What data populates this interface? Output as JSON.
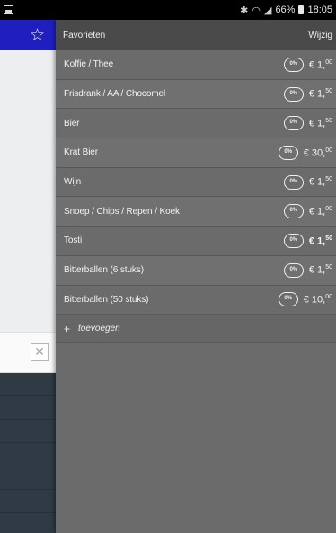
{
  "status_bar": {
    "battery": "66%",
    "time": "18:05",
    "icons": [
      "notification-icon",
      "bluetooth-icon",
      "wifi-icon",
      "signal-icon",
      "battery-icon"
    ]
  },
  "background_app": {
    "header_color": "#1f1fc0",
    "icons": [
      "star-icon",
      "close-icon"
    ]
  },
  "favorites": {
    "title": "Favorieten",
    "edit_label": "Wijzig",
    "discount_label": "0%",
    "currency": "€",
    "items": [
      {
        "name": "Koffie / Thee",
        "price_main": "€ 1,",
        "price_cents": "00",
        "bold": false
      },
      {
        "name": "Frisdrank / AA / Chocomel",
        "price_main": "€ 1,",
        "price_cents": "50",
        "bold": false
      },
      {
        "name": "Bier",
        "price_main": "€ 1,",
        "price_cents": "50",
        "bold": false
      },
      {
        "name": "Krat Bier",
        "price_main": "€ 30,",
        "price_cents": "00",
        "bold": false
      },
      {
        "name": "Wijn",
        "price_main": "€ 1,",
        "price_cents": "50",
        "bold": false
      },
      {
        "name": "Snoep / Chips / Repen / Koek",
        "price_main": "€ 1,",
        "price_cents": "00",
        "bold": false
      },
      {
        "name": "Tosti",
        "price_main": "€ 1,",
        "price_cents": "50",
        "bold": true
      },
      {
        "name": "Bitterballen (6 stuks)",
        "price_main": "€ 1,",
        "price_cents": "50",
        "bold": false
      },
      {
        "name": "Bitterballen (50 stuks)",
        "price_main": "€ 10,",
        "price_cents": "00",
        "bold": false
      }
    ],
    "add_label": "toevoegen"
  }
}
